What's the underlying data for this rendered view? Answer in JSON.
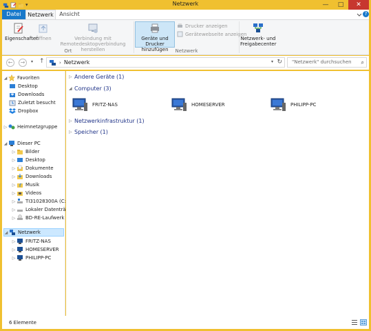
{
  "window": {
    "title": "Netzwerk",
    "accent": "#f0c030"
  },
  "tabs": [
    {
      "label": "Datei"
    },
    {
      "label": "Netzwerk"
    },
    {
      "label": "Ansicht"
    }
  ],
  "ribbon": {
    "eigenschaften": "Eigenschaften",
    "oeffnen": "Öffnen",
    "remote_line1": "Verbindung mit",
    "remote_line2": "Remotedesktopverbindung herstellen",
    "group_ort": "Ort",
    "geraete_line1": "Geräte und Drucker",
    "geraete_line2": "hinzufügen",
    "drucker": "Drucker anzeigen",
    "webseite": "Gerätewebseite anzeigen",
    "group_netzwerk": "Netzwerk",
    "netzwerkcenter_line1": "Netzwerk- und",
    "netzwerkcenter_line2": "Freigabecenter"
  },
  "address": {
    "path": "Netzwerk",
    "search_placeholder": "\"Netzwerk\" durchsuchen"
  },
  "nav": {
    "favoriten": "Favoriten",
    "desktop": "Desktop",
    "downloads": "Downloads",
    "zuletzt": "Zuletzt besucht",
    "dropbox": "Dropbox",
    "heimnetzgruppe": "Heimnetzgruppe",
    "dieser_pc": "Dieser PC",
    "bilder": "Bilder",
    "desktop2": "Desktop",
    "dokumente": "Dokumente",
    "downloads2": "Downloads",
    "musik": "Musik",
    "videos": "Videos",
    "drive_c": "TI31028300A (C:)",
    "lokaler": "Lokaler Datenträger",
    "bd": "BD-RE-Laufwerk (E:)",
    "netzwerk": "Netzwerk",
    "fritz": "FRITZ-NAS",
    "homeserver": "HOMESERVER",
    "philipp": "PHILIPP-PC"
  },
  "content": {
    "groups": [
      {
        "label": "Andere Geräte (1)"
      },
      {
        "label": "Computer (3)"
      },
      {
        "label": "Netzwerkinfrastruktur (1)"
      },
      {
        "label": "Speicher (1)"
      }
    ],
    "computers": [
      {
        "label": "FRITZ-NAS"
      },
      {
        "label": "HOMESERVER"
      },
      {
        "label": "PHILIPP-PC"
      }
    ]
  },
  "status": {
    "count": "6 Elemente"
  }
}
